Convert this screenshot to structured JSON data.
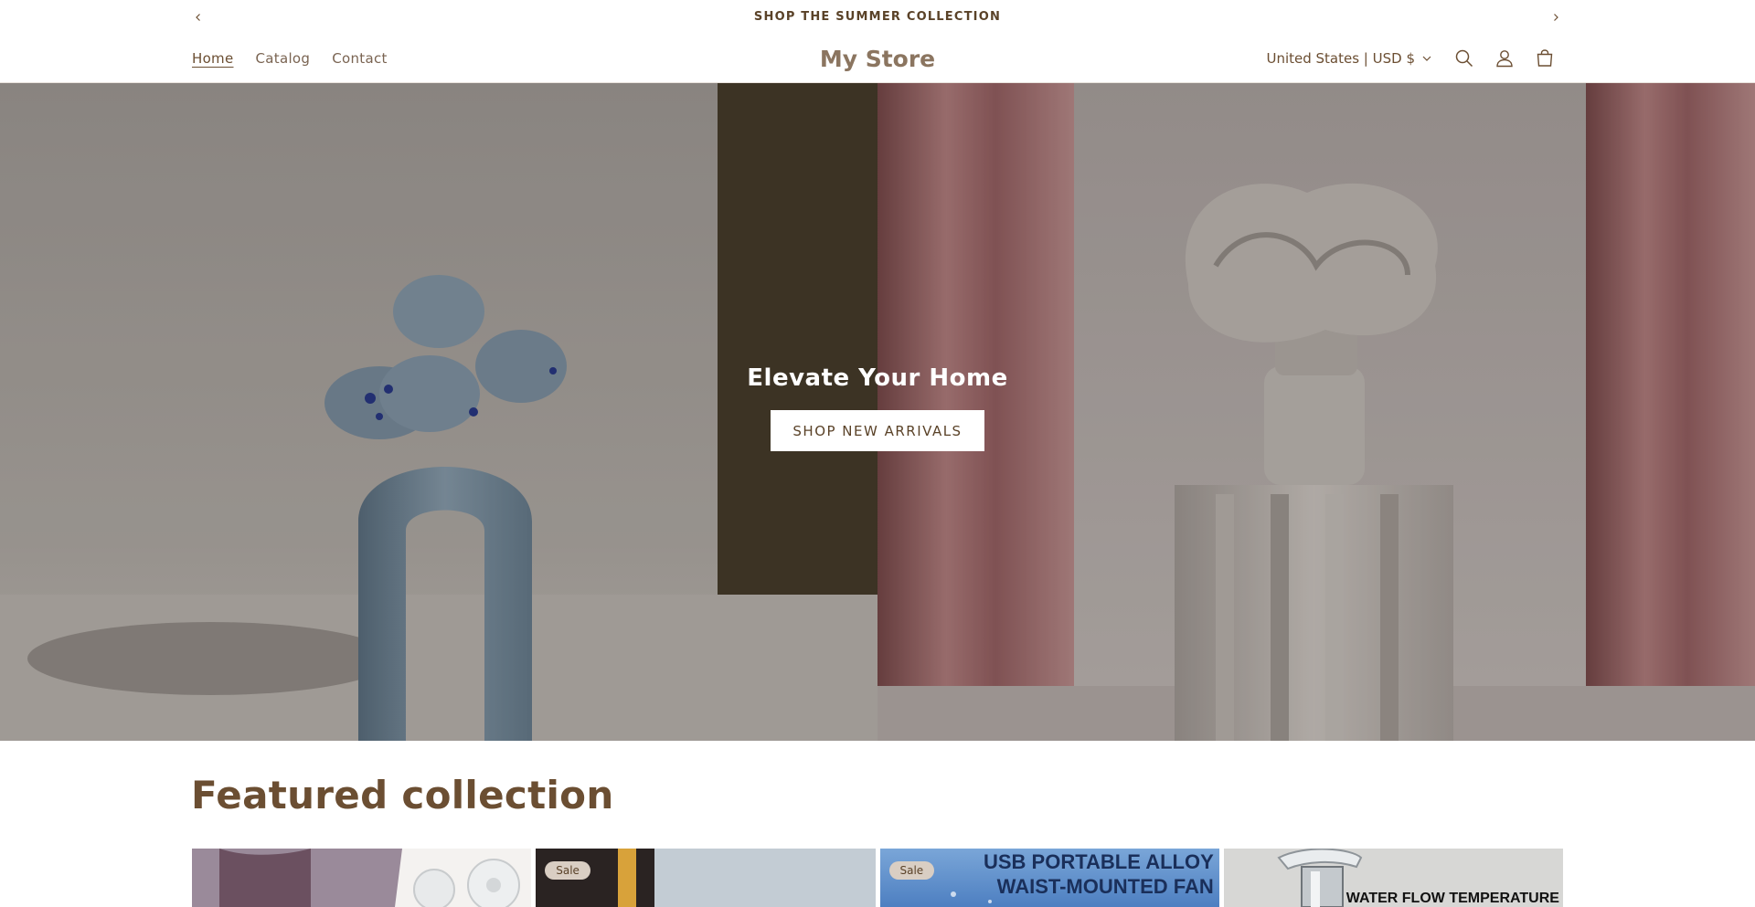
{
  "announcement": {
    "text": "SHOP THE SUMMER COLLECTION",
    "prev_icon": "chevron-left-icon",
    "next_icon": "chevron-right-icon"
  },
  "header": {
    "nav": [
      {
        "label": "Home",
        "active": true
      },
      {
        "label": "Catalog",
        "active": false
      },
      {
        "label": "Contact",
        "active": false
      }
    ],
    "logo": "My Store",
    "currency": "United States | USD $",
    "icons": [
      "search-icon",
      "account-icon",
      "cart-icon"
    ]
  },
  "hero": {
    "title": "Elevate Your Home",
    "button_label": "SHOP NEW ARRIVALS"
  },
  "featured": {
    "title": "Featured collection",
    "products": [
      {
        "badge": "",
        "image_text": ""
      },
      {
        "badge": "Sale",
        "image_text": ""
      },
      {
        "badge": "Sale",
        "image_text_line1": "USB PORTABLE ALLOY",
        "image_text_line2": "WAIST-MOUNTED FAN"
      },
      {
        "badge": "",
        "image_text": "WATER FLOW TEMPERATURE"
      }
    ]
  },
  "colors": {
    "brand_text": "#6b4e32",
    "logo": "#8b7560",
    "badge_bg": "#d9cec3"
  }
}
